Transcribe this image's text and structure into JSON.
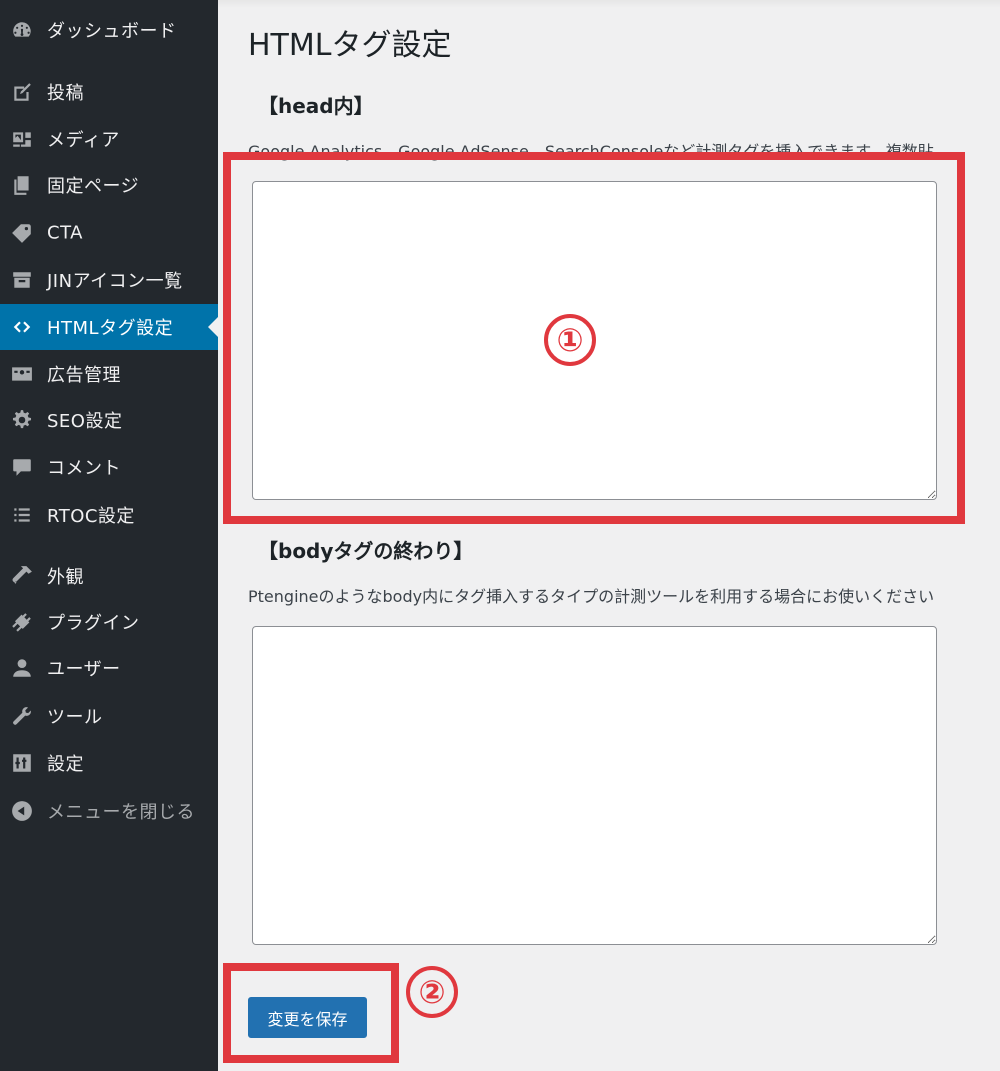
{
  "sidebar": {
    "items": [
      {
        "label": "ダッシュボード",
        "icon": "dashboard-icon"
      },
      {
        "label": "投稿",
        "icon": "post-icon"
      },
      {
        "label": "メディア",
        "icon": "media-icon"
      },
      {
        "label": "固定ページ",
        "icon": "page-icon"
      },
      {
        "label": "CTA",
        "icon": "tag-icon"
      },
      {
        "label": "JINアイコン一覧",
        "icon": "archive-icon"
      },
      {
        "label": "HTMLタグ設定",
        "icon": "code-icon",
        "active": true
      },
      {
        "label": "広告管理",
        "icon": "ad-icon"
      },
      {
        "label": "SEO設定",
        "icon": "gear-icon"
      },
      {
        "label": "コメント",
        "icon": "comment-icon"
      },
      {
        "label": "RTOC設定",
        "icon": "list-icon"
      },
      {
        "label": "外観",
        "icon": "appearance-icon"
      },
      {
        "label": "プラグイン",
        "icon": "plugin-icon"
      },
      {
        "label": "ユーザー",
        "icon": "user-icon"
      },
      {
        "label": "ツール",
        "icon": "wrench-icon"
      },
      {
        "label": "設定",
        "icon": "settings-icon"
      },
      {
        "label": "メニューを閉じる",
        "icon": "collapse-icon"
      }
    ]
  },
  "main": {
    "title": "HTMLタグ設定",
    "head_section": {
      "heading": "【head内】",
      "description": "Google Analytics、Google AdSense、SearchConsoleなど計測タグを挿入できます。複数貼",
      "value": ""
    },
    "body_section": {
      "heading": "【bodyタグの終わり】",
      "description": "Ptengineのようなbody内にタグ挿入するタイプの計測ツールを利用する場合にお使いください",
      "value": ""
    },
    "save_label": "変更を保存"
  },
  "annotations": {
    "marker1": "①",
    "marker2": "②",
    "color": "#e0383e"
  },
  "colors": {
    "sidebar_bg": "#23282d",
    "active_bg": "#0073aa",
    "button_bg": "#2271b1",
    "page_bg": "#f0f0f1"
  }
}
